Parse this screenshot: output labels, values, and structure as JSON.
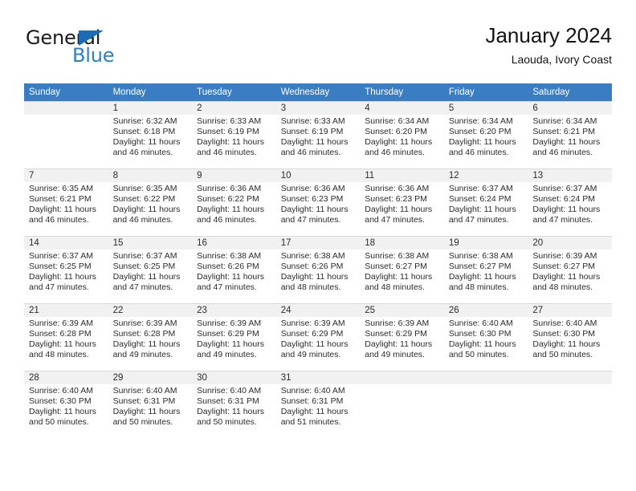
{
  "brand": {
    "word_top": "General",
    "word_bottom": "Blue",
    "accent_color": "#2a7fc9",
    "triangle_color": "#1b6cb3",
    "triangle_icon": "triangle-icon"
  },
  "header": {
    "title": "January 2024",
    "subtitle": "Laouda, Ivory Coast"
  },
  "calendar": {
    "header_bg": "#3a7dc2",
    "header_text_color": "#ffffff",
    "daynum_strip_bg": "#f1f1f1",
    "weekday_headers": [
      "Sunday",
      "Monday",
      "Tuesday",
      "Wednesday",
      "Thursday",
      "Friday",
      "Saturday"
    ],
    "weeks": [
      [
        {
          "day": "",
          "empty": true,
          "sunrise": "",
          "sunset": "",
          "daylight_1": "",
          "daylight_2": ""
        },
        {
          "day": "1",
          "sunrise": "Sunrise: 6:32 AM",
          "sunset": "Sunset: 6:18 PM",
          "daylight_1": "Daylight: 11 hours",
          "daylight_2": "and 46 minutes."
        },
        {
          "day": "2",
          "sunrise": "Sunrise: 6:33 AM",
          "sunset": "Sunset: 6:19 PM",
          "daylight_1": "Daylight: 11 hours",
          "daylight_2": "and 46 minutes."
        },
        {
          "day": "3",
          "sunrise": "Sunrise: 6:33 AM",
          "sunset": "Sunset: 6:19 PM",
          "daylight_1": "Daylight: 11 hours",
          "daylight_2": "and 46 minutes."
        },
        {
          "day": "4",
          "sunrise": "Sunrise: 6:34 AM",
          "sunset": "Sunset: 6:20 PM",
          "daylight_1": "Daylight: 11 hours",
          "daylight_2": "and 46 minutes."
        },
        {
          "day": "5",
          "sunrise": "Sunrise: 6:34 AM",
          "sunset": "Sunset: 6:20 PM",
          "daylight_1": "Daylight: 11 hours",
          "daylight_2": "and 46 minutes."
        },
        {
          "day": "6",
          "sunrise": "Sunrise: 6:34 AM",
          "sunset": "Sunset: 6:21 PM",
          "daylight_1": "Daylight: 11 hours",
          "daylight_2": "and 46 minutes."
        }
      ],
      [
        {
          "day": "7",
          "sunrise": "Sunrise: 6:35 AM",
          "sunset": "Sunset: 6:21 PM",
          "daylight_1": "Daylight: 11 hours",
          "daylight_2": "and 46 minutes."
        },
        {
          "day": "8",
          "sunrise": "Sunrise: 6:35 AM",
          "sunset": "Sunset: 6:22 PM",
          "daylight_1": "Daylight: 11 hours",
          "daylight_2": "and 46 minutes."
        },
        {
          "day": "9",
          "sunrise": "Sunrise: 6:36 AM",
          "sunset": "Sunset: 6:22 PM",
          "daylight_1": "Daylight: 11 hours",
          "daylight_2": "and 46 minutes."
        },
        {
          "day": "10",
          "sunrise": "Sunrise: 6:36 AM",
          "sunset": "Sunset: 6:23 PM",
          "daylight_1": "Daylight: 11 hours",
          "daylight_2": "and 47 minutes."
        },
        {
          "day": "11",
          "sunrise": "Sunrise: 6:36 AM",
          "sunset": "Sunset: 6:23 PM",
          "daylight_1": "Daylight: 11 hours",
          "daylight_2": "and 47 minutes."
        },
        {
          "day": "12",
          "sunrise": "Sunrise: 6:37 AM",
          "sunset": "Sunset: 6:24 PM",
          "daylight_1": "Daylight: 11 hours",
          "daylight_2": "and 47 minutes."
        },
        {
          "day": "13",
          "sunrise": "Sunrise: 6:37 AM",
          "sunset": "Sunset: 6:24 PM",
          "daylight_1": "Daylight: 11 hours",
          "daylight_2": "and 47 minutes."
        }
      ],
      [
        {
          "day": "14",
          "sunrise": "Sunrise: 6:37 AM",
          "sunset": "Sunset: 6:25 PM",
          "daylight_1": "Daylight: 11 hours",
          "daylight_2": "and 47 minutes."
        },
        {
          "day": "15",
          "sunrise": "Sunrise: 6:37 AM",
          "sunset": "Sunset: 6:25 PM",
          "daylight_1": "Daylight: 11 hours",
          "daylight_2": "and 47 minutes."
        },
        {
          "day": "16",
          "sunrise": "Sunrise: 6:38 AM",
          "sunset": "Sunset: 6:26 PM",
          "daylight_1": "Daylight: 11 hours",
          "daylight_2": "and 47 minutes."
        },
        {
          "day": "17",
          "sunrise": "Sunrise: 6:38 AM",
          "sunset": "Sunset: 6:26 PM",
          "daylight_1": "Daylight: 11 hours",
          "daylight_2": "and 48 minutes."
        },
        {
          "day": "18",
          "sunrise": "Sunrise: 6:38 AM",
          "sunset": "Sunset: 6:27 PM",
          "daylight_1": "Daylight: 11 hours",
          "daylight_2": "and 48 minutes."
        },
        {
          "day": "19",
          "sunrise": "Sunrise: 6:38 AM",
          "sunset": "Sunset: 6:27 PM",
          "daylight_1": "Daylight: 11 hours",
          "daylight_2": "and 48 minutes."
        },
        {
          "day": "20",
          "sunrise": "Sunrise: 6:39 AM",
          "sunset": "Sunset: 6:27 PM",
          "daylight_1": "Daylight: 11 hours",
          "daylight_2": "and 48 minutes."
        }
      ],
      [
        {
          "day": "21",
          "sunrise": "Sunrise: 6:39 AM",
          "sunset": "Sunset: 6:28 PM",
          "daylight_1": "Daylight: 11 hours",
          "daylight_2": "and 48 minutes."
        },
        {
          "day": "22",
          "sunrise": "Sunrise: 6:39 AM",
          "sunset": "Sunset: 6:28 PM",
          "daylight_1": "Daylight: 11 hours",
          "daylight_2": "and 49 minutes."
        },
        {
          "day": "23",
          "sunrise": "Sunrise: 6:39 AM",
          "sunset": "Sunset: 6:29 PM",
          "daylight_1": "Daylight: 11 hours",
          "daylight_2": "and 49 minutes."
        },
        {
          "day": "24",
          "sunrise": "Sunrise: 6:39 AM",
          "sunset": "Sunset: 6:29 PM",
          "daylight_1": "Daylight: 11 hours",
          "daylight_2": "and 49 minutes."
        },
        {
          "day": "25",
          "sunrise": "Sunrise: 6:39 AM",
          "sunset": "Sunset: 6:29 PM",
          "daylight_1": "Daylight: 11 hours",
          "daylight_2": "and 49 minutes."
        },
        {
          "day": "26",
          "sunrise": "Sunrise: 6:40 AM",
          "sunset": "Sunset: 6:30 PM",
          "daylight_1": "Daylight: 11 hours",
          "daylight_2": "and 50 minutes."
        },
        {
          "day": "27",
          "sunrise": "Sunrise: 6:40 AM",
          "sunset": "Sunset: 6:30 PM",
          "daylight_1": "Daylight: 11 hours",
          "daylight_2": "and 50 minutes."
        }
      ],
      [
        {
          "day": "28",
          "sunrise": "Sunrise: 6:40 AM",
          "sunset": "Sunset: 6:30 PM",
          "daylight_1": "Daylight: 11 hours",
          "daylight_2": "and 50 minutes."
        },
        {
          "day": "29",
          "sunrise": "Sunrise: 6:40 AM",
          "sunset": "Sunset: 6:31 PM",
          "daylight_1": "Daylight: 11 hours",
          "daylight_2": "and 50 minutes."
        },
        {
          "day": "30",
          "sunrise": "Sunrise: 6:40 AM",
          "sunset": "Sunset: 6:31 PM",
          "daylight_1": "Daylight: 11 hours",
          "daylight_2": "and 50 minutes."
        },
        {
          "day": "31",
          "sunrise": "Sunrise: 6:40 AM",
          "sunset": "Sunset: 6:31 PM",
          "daylight_1": "Daylight: 11 hours",
          "daylight_2": "and 51 minutes."
        },
        {
          "day": "",
          "empty": true,
          "sunrise": "",
          "sunset": "",
          "daylight_1": "",
          "daylight_2": ""
        },
        {
          "day": "",
          "empty": true,
          "sunrise": "",
          "sunset": "",
          "daylight_1": "",
          "daylight_2": ""
        },
        {
          "day": "",
          "empty": true,
          "sunrise": "",
          "sunset": "",
          "daylight_1": "",
          "daylight_2": ""
        }
      ]
    ]
  }
}
